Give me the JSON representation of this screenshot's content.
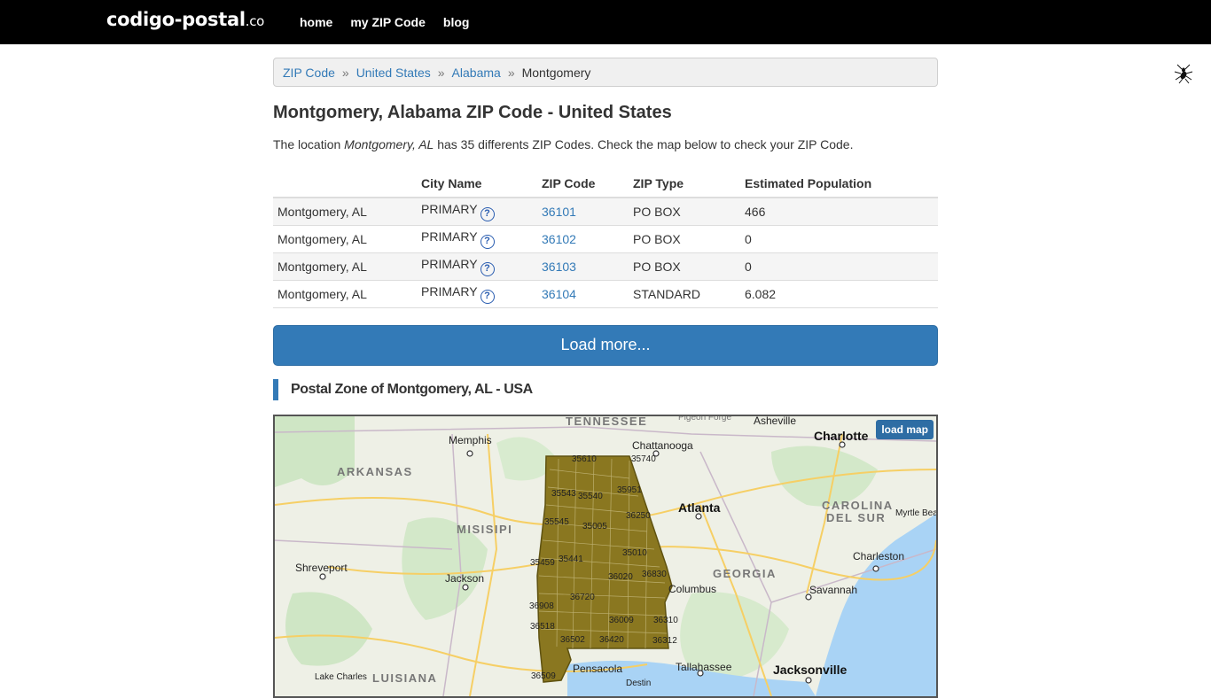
{
  "nav": {
    "brand_main": "codigo-postal",
    "brand_tld": ".co",
    "links": [
      "home",
      "my ZIP Code",
      "blog"
    ]
  },
  "breadcrumb": {
    "items": [
      "ZIP Code",
      "United States",
      "Alabama"
    ],
    "separator": "»",
    "current": "Montgomery"
  },
  "page": {
    "title": "Montgomery, Alabama ZIP Code - United States",
    "intro_prefix": "The location ",
    "intro_location": "Montgomery, AL",
    "intro_suffix": " has 35 differents ZIP Codes. Check the map below to check your ZIP Code."
  },
  "table": {
    "headers": [
      "",
      "City Name",
      "ZIP Code",
      "ZIP Type",
      "Estimated Population"
    ],
    "rows": [
      {
        "place": "Montgomery, AL",
        "city_name": "PRIMARY",
        "zip": "36101",
        "type": "PO BOX",
        "population": "466"
      },
      {
        "place": "Montgomery, AL",
        "city_name": "PRIMARY",
        "zip": "36102",
        "type": "PO BOX",
        "population": "0"
      },
      {
        "place": "Montgomery, AL",
        "city_name": "PRIMARY",
        "zip": "36103",
        "type": "PO BOX",
        "population": "0"
      },
      {
        "place": "Montgomery, AL",
        "city_name": "PRIMARY",
        "zip": "36104",
        "type": "STANDARD",
        "population": "6.082"
      }
    ],
    "help_icon": "?"
  },
  "load_more": "Load more...",
  "section_title": "Postal Zone of Montgomery, AL - USA",
  "map": {
    "load_map": "load map",
    "states": [
      "TENNESSEE",
      "ARKANSAS",
      "MISISIPI",
      "GEORGIA",
      "CAROLINA",
      "DEL SUR",
      "LUISIANA"
    ],
    "cities": [
      "Memphis",
      "Chattanooga",
      "Asheville",
      "Pigeon Forge",
      "Charlotte",
      "Atlanta",
      "Jackson",
      "Shreveport",
      "Columbus",
      "Charleston",
      "Savannah",
      "Tallahassee",
      "Lake Charles",
      "Pensacola",
      "Destin",
      "Myrtle Beach",
      "Jacksonville"
    ],
    "zips": [
      "35610",
      "35740",
      "35543",
      "35540",
      "35951",
      "35545",
      "35005",
      "36250",
      "35459",
      "35441",
      "35010",
      "36020",
      "36830",
      "36720",
      "36908",
      "36009",
      "36310",
      "36518",
      "36502",
      "36420",
      "36312",
      "36509"
    ]
  },
  "colors": {
    "accent": "#337ab7",
    "navbar": "#000000",
    "zip_fill": "#7d6b1e"
  },
  "icons": [
    "help-circle-icon",
    "insect-icon"
  ]
}
